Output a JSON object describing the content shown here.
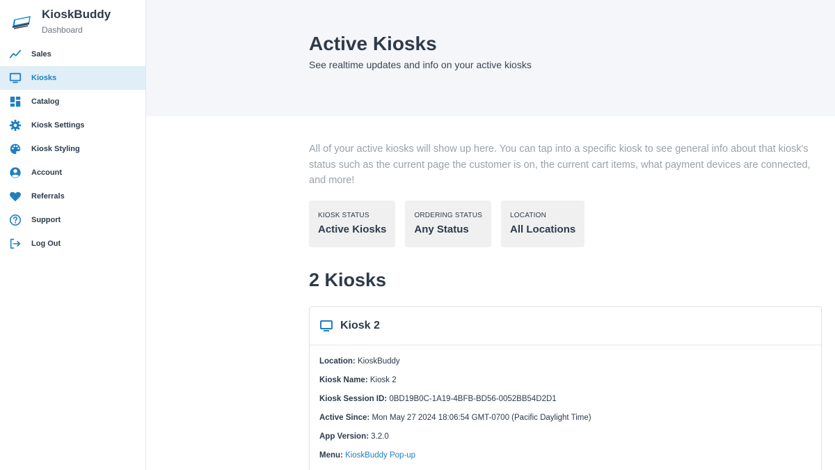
{
  "app": {
    "title": "KioskBuddy",
    "subtitle": "Dashboard"
  },
  "sidebar": {
    "items": [
      {
        "label": "Sales",
        "icon": "chart-line-icon"
      },
      {
        "label": "Kiosks",
        "icon": "monitor-icon",
        "active": true
      },
      {
        "label": "Catalog",
        "icon": "grid-icon"
      },
      {
        "label": "Kiosk Settings",
        "icon": "gear-icon"
      },
      {
        "label": "Kiosk Styling",
        "icon": "palette-icon"
      },
      {
        "label": "Account",
        "icon": "user-circle-icon"
      },
      {
        "label": "Referrals",
        "icon": "heart-icon"
      },
      {
        "label": "Support",
        "icon": "question-circle-icon"
      },
      {
        "label": "Log Out",
        "icon": "logout-icon"
      }
    ]
  },
  "header": {
    "title": "Active Kiosks",
    "subtitle": "See realtime updates and info on your active kiosks"
  },
  "main": {
    "intro": "All of your active kiosks will show up here. You can tap into a specific kiosk to see general info about that kiosk's status such as the current page the customer is on, the current cart items, what payment devices are connected, and more!",
    "filters": [
      {
        "label": "KIOSK STATUS",
        "value": "Active Kiosks"
      },
      {
        "label": "ORDERING STATUS",
        "value": "Any Status"
      },
      {
        "label": "LOCATION",
        "value": "All Locations"
      }
    ],
    "count": "2 Kiosks",
    "card": {
      "title": "Kiosk 2",
      "rows": [
        {
          "label": "Location:",
          "value": "KioskBuddy"
        },
        {
          "label": "Kiosk Name:",
          "value": "Kiosk 2"
        },
        {
          "label": "Kiosk Session ID:",
          "value": "0BD19B0C-1A19-4BFB-BD56-0052BB54D2D1"
        },
        {
          "label": "Active Since:",
          "value": "Mon May 27 2024 18:06:54 GMT-0700 (Pacific Daylight Time)"
        },
        {
          "label": "App Version:",
          "value": "3.2.0"
        },
        {
          "label": "Menu:",
          "value": "KioskBuddy Pop-up"
        }
      ]
    }
  },
  "colors": {
    "accent": "#1f7fc3",
    "text": "#2d3a4a",
    "active_bg": "#e0eef8"
  }
}
